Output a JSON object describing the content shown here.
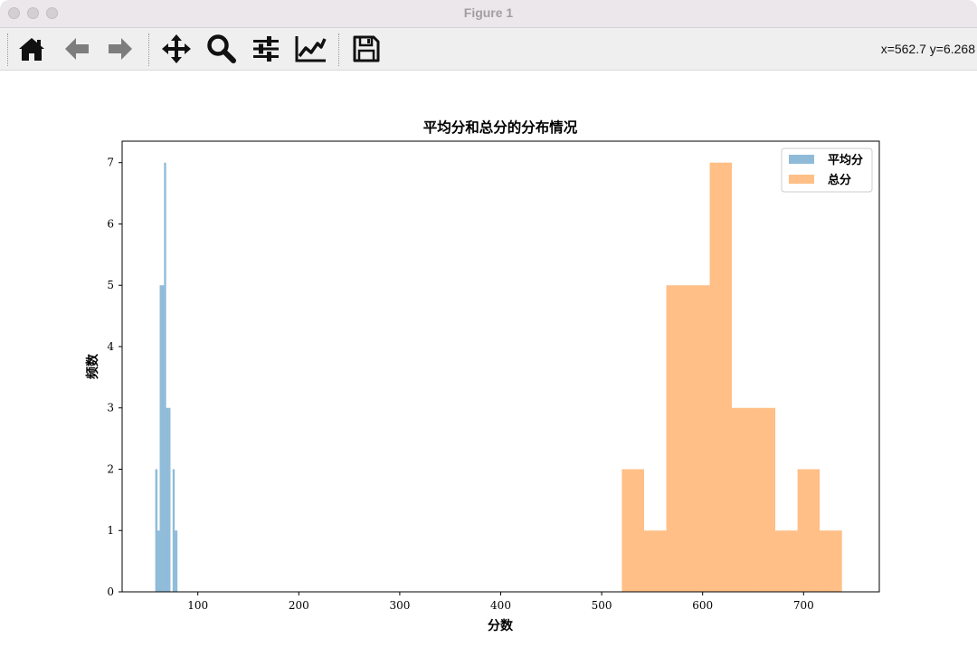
{
  "window": {
    "title": "Figure 1"
  },
  "toolbar": {
    "buttons": [
      {
        "name": "home-icon"
      },
      {
        "name": "back-arrow-icon"
      },
      {
        "name": "forward-arrow-icon"
      },
      {
        "name": "pan-move-icon"
      },
      {
        "name": "zoom-magnifier-icon"
      },
      {
        "name": "configure-subplots-icon"
      },
      {
        "name": "edit-axis-line-icon"
      },
      {
        "name": "save-floppy-icon"
      }
    ],
    "coords": "x=562.7 y=6.268"
  },
  "chart_data": {
    "type": "bar",
    "title": "平均分和总分的分布情况",
    "xlabel": "分数",
    "ylabel": "频数",
    "xlim": [
      25,
      775
    ],
    "ylim": [
      0,
      7.35
    ],
    "xticks": [
      100,
      200,
      300,
      400,
      500,
      600,
      700
    ],
    "yticks": [
      0,
      1,
      2,
      3,
      4,
      5,
      6,
      7
    ],
    "legend_position": "top-right",
    "series": [
      {
        "name": "平均分",
        "color": "#1f77b4",
        "alpha": 0.5,
        "bins": [
          {
            "x0": 57.8,
            "x1": 60.0,
            "count": 2
          },
          {
            "x0": 60.0,
            "x1": 62.2,
            "count": 1
          },
          {
            "x0": 62.2,
            "x1": 64.3,
            "count": 5
          },
          {
            "x0": 64.3,
            "x1": 66.5,
            "count": 5
          },
          {
            "x0": 66.5,
            "x1": 68.6,
            "count": 7
          },
          {
            "x0": 68.6,
            "x1": 70.8,
            "count": 3
          },
          {
            "x0": 70.8,
            "x1": 72.9,
            "count": 3
          },
          {
            "x0": 72.9,
            "x1": 75.0,
            "count": 0
          },
          {
            "x0": 75.0,
            "x1": 77.1,
            "count": 2
          },
          {
            "x0": 77.1,
            "x1": 79.8,
            "count": 1
          }
        ]
      },
      {
        "name": "总分",
        "color": "#ff7f0e",
        "alpha": 0.5,
        "bins": [
          {
            "x0": 520,
            "x1": 542,
            "count": 2
          },
          {
            "x0": 542,
            "x1": 564,
            "count": 1
          },
          {
            "x0": 564,
            "x1": 586,
            "count": 5
          },
          {
            "x0": 586,
            "x1": 607,
            "count": 5
          },
          {
            "x0": 607,
            "x1": 629,
            "count": 7
          },
          {
            "x0": 629,
            "x1": 651,
            "count": 3
          },
          {
            "x0": 651,
            "x1": 672,
            "count": 3
          },
          {
            "x0": 672,
            "x1": 694,
            "count": 1
          },
          {
            "x0": 694,
            "x1": 716,
            "count": 2
          },
          {
            "x0": 716,
            "x1": 738,
            "count": 1
          }
        ]
      }
    ]
  }
}
